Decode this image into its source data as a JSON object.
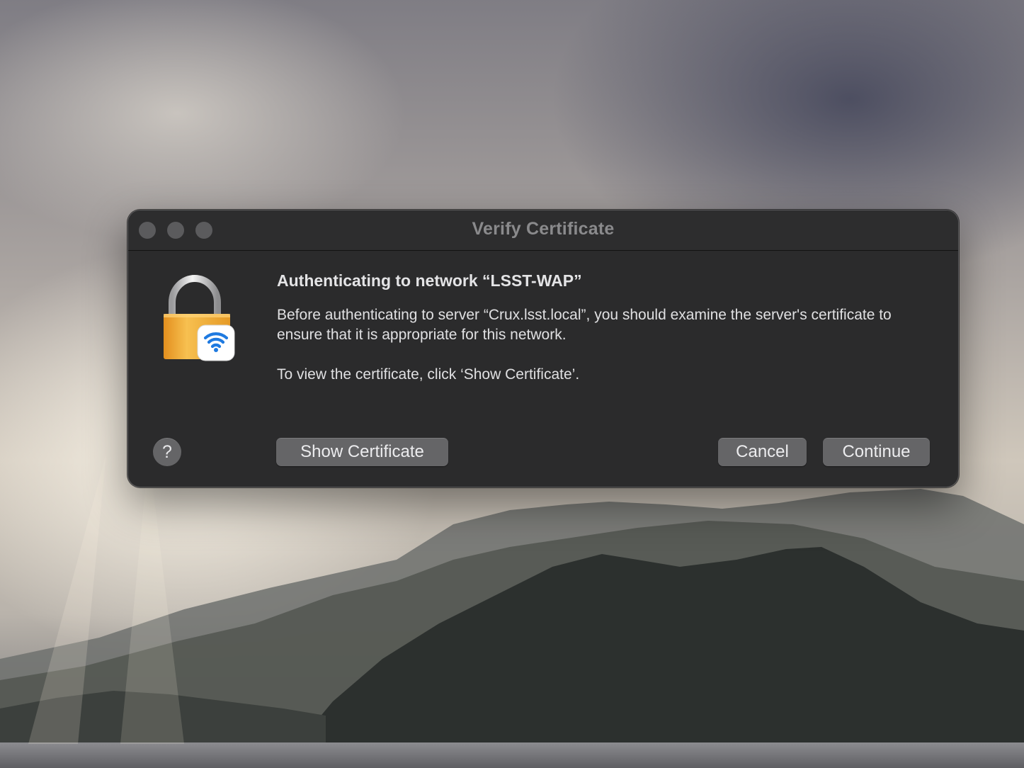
{
  "window": {
    "title": "Verify Certificate"
  },
  "icons": {
    "dialog_icon": "lock-with-wifi-icon",
    "help": "question-mark-icon"
  },
  "content": {
    "heading": "Authenticating to network “LSST-WAP”",
    "paragraph1": "Before authenticating to server “Crux.lsst.local”, you should examine the server's certificate to ensure that it is appropriate for this network.",
    "paragraph2": "To view the certificate, click ‘Show Certificate’."
  },
  "buttons": {
    "help_label": "?",
    "show_certificate": "Show Certificate",
    "cancel": "Cancel",
    "continue": "Continue"
  },
  "colors": {
    "dialog_background": "#2b2b2c",
    "button_background": "#656567",
    "lock_body": "#f0a830",
    "wifi_blue": "#1f7ae0"
  }
}
